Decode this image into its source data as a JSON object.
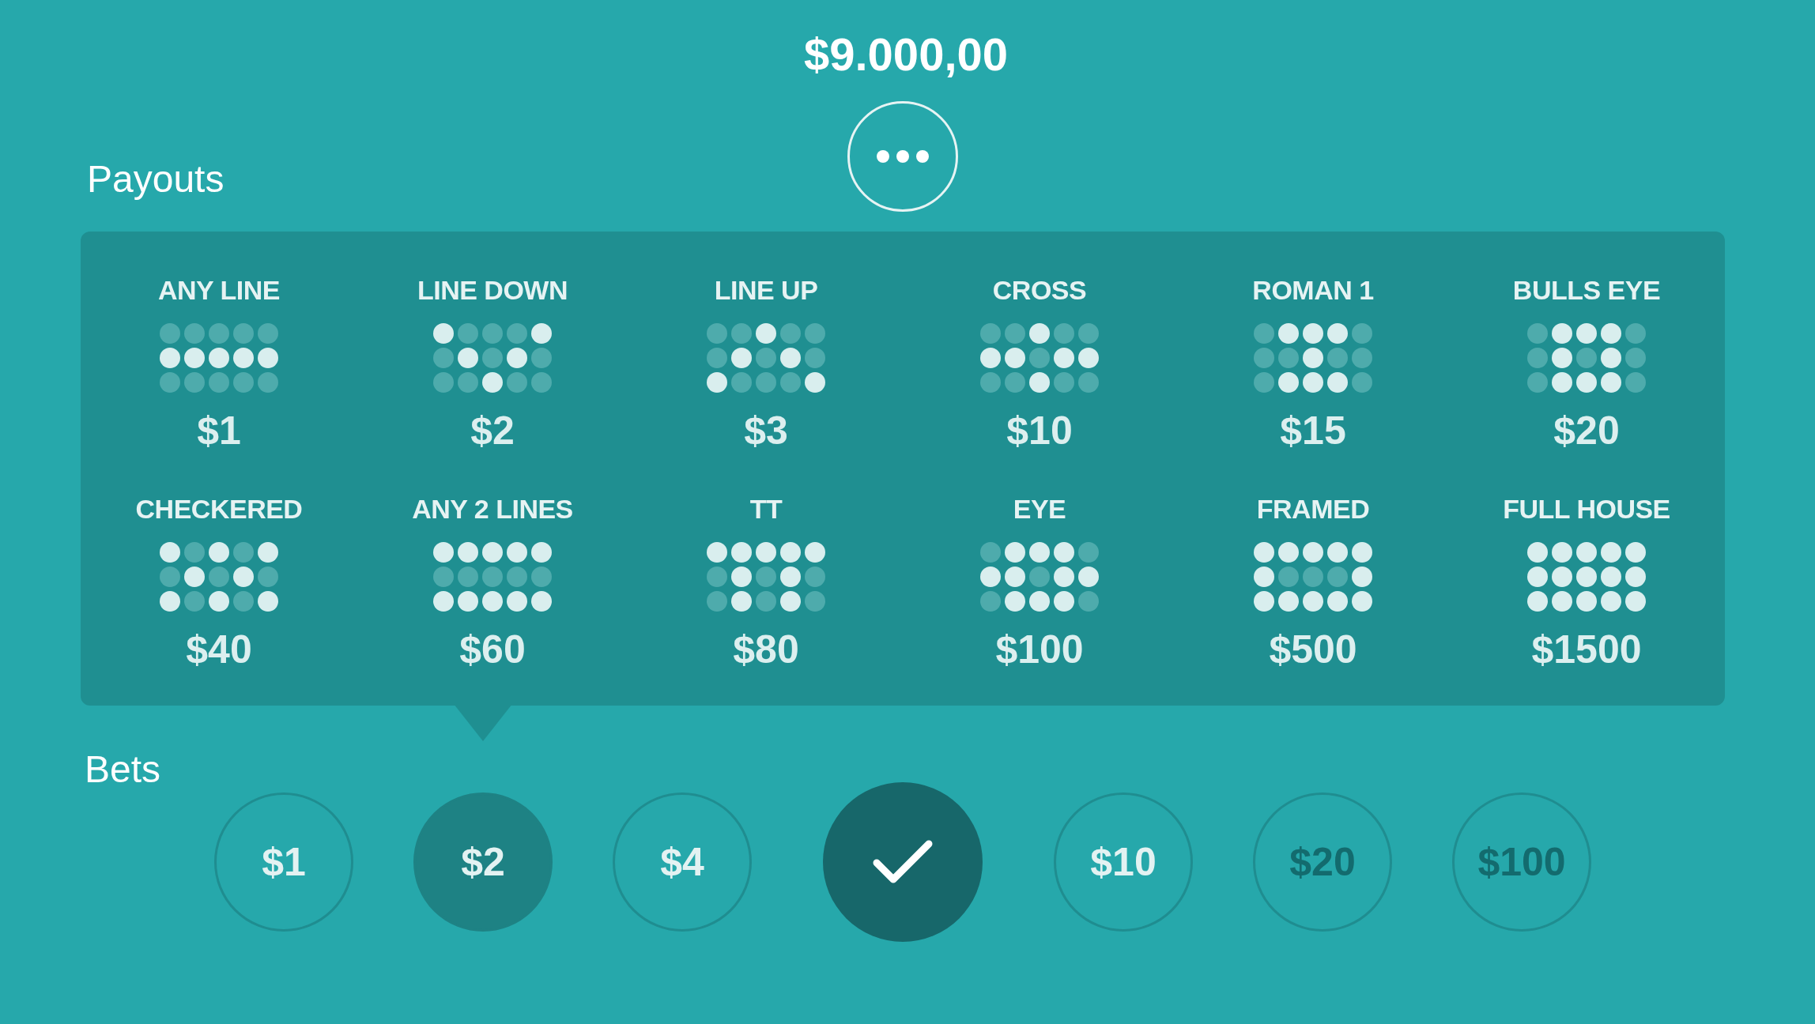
{
  "balance": "$9.000,00",
  "payouts": {
    "label": "Payouts",
    "items": [
      {
        "name": "ANY LINE",
        "prize": "$1",
        "pattern": [
          [
            false,
            false,
            false,
            false,
            false
          ],
          [
            true,
            true,
            true,
            true,
            true
          ],
          [
            false,
            false,
            false,
            false,
            false
          ]
        ]
      },
      {
        "name": "LINE DOWN",
        "prize": "$2",
        "pattern": [
          [
            true,
            false,
            false,
            false,
            true
          ],
          [
            false,
            true,
            false,
            true,
            false
          ],
          [
            false,
            false,
            true,
            false,
            false
          ]
        ]
      },
      {
        "name": "LINE UP",
        "prize": "$3",
        "pattern": [
          [
            false,
            false,
            true,
            false,
            false
          ],
          [
            false,
            true,
            false,
            true,
            false
          ],
          [
            true,
            false,
            false,
            false,
            true
          ]
        ]
      },
      {
        "name": "CROSS",
        "prize": "$10",
        "pattern": [
          [
            false,
            false,
            true,
            false,
            false
          ],
          [
            true,
            true,
            false,
            true,
            true
          ],
          [
            false,
            false,
            true,
            false,
            false
          ]
        ]
      },
      {
        "name": "ROMAN 1",
        "prize": "$15",
        "pattern": [
          [
            false,
            true,
            true,
            true,
            false
          ],
          [
            false,
            false,
            true,
            false,
            false
          ],
          [
            false,
            true,
            true,
            true,
            false
          ]
        ]
      },
      {
        "name": "BULLS EYE",
        "prize": "$20",
        "pattern": [
          [
            false,
            true,
            true,
            true,
            false
          ],
          [
            false,
            true,
            false,
            true,
            false
          ],
          [
            false,
            true,
            true,
            true,
            false
          ]
        ]
      },
      {
        "name": "CHECKERED",
        "prize": "$40",
        "pattern": [
          [
            true,
            false,
            true,
            false,
            true
          ],
          [
            false,
            true,
            false,
            true,
            false
          ],
          [
            true,
            false,
            true,
            false,
            true
          ]
        ]
      },
      {
        "name": "ANY 2 LINES",
        "prize": "$60",
        "pattern": [
          [
            true,
            true,
            true,
            true,
            true
          ],
          [
            false,
            false,
            false,
            false,
            false
          ],
          [
            true,
            true,
            true,
            true,
            true
          ]
        ]
      },
      {
        "name": "TT",
        "prize": "$80",
        "pattern": [
          [
            true,
            true,
            true,
            true,
            true
          ],
          [
            false,
            true,
            false,
            true,
            false
          ],
          [
            false,
            true,
            false,
            true,
            false
          ]
        ]
      },
      {
        "name": "EYE",
        "prize": "$100",
        "pattern": [
          [
            false,
            true,
            true,
            true,
            false
          ],
          [
            true,
            true,
            false,
            true,
            true
          ],
          [
            false,
            true,
            true,
            true,
            false
          ]
        ]
      },
      {
        "name": "FRAMED",
        "prize": "$500",
        "pattern": [
          [
            true,
            true,
            true,
            true,
            true
          ],
          [
            true,
            false,
            false,
            false,
            true
          ],
          [
            true,
            true,
            true,
            true,
            true
          ]
        ]
      },
      {
        "name": "FULL HOUSE",
        "prize": "$1500",
        "pattern": [
          [
            true,
            true,
            true,
            true,
            true
          ],
          [
            true,
            true,
            true,
            true,
            true
          ],
          [
            true,
            true,
            true,
            true,
            true
          ]
        ]
      }
    ]
  },
  "bets": {
    "label": "Bets",
    "items": [
      {
        "kind": "amount",
        "label": "$1",
        "selected": false,
        "disabled": false
      },
      {
        "kind": "amount",
        "label": "$2",
        "selected": true,
        "disabled": false
      },
      {
        "kind": "amount",
        "label": "$4",
        "selected": false,
        "disabled": false
      },
      {
        "kind": "confirm"
      },
      {
        "kind": "amount",
        "label": "$10",
        "selected": false,
        "disabled": false
      },
      {
        "kind": "amount",
        "label": "$20",
        "selected": false,
        "disabled": true
      },
      {
        "kind": "amount",
        "label": "$100",
        "selected": false,
        "disabled": true
      }
    ]
  }
}
